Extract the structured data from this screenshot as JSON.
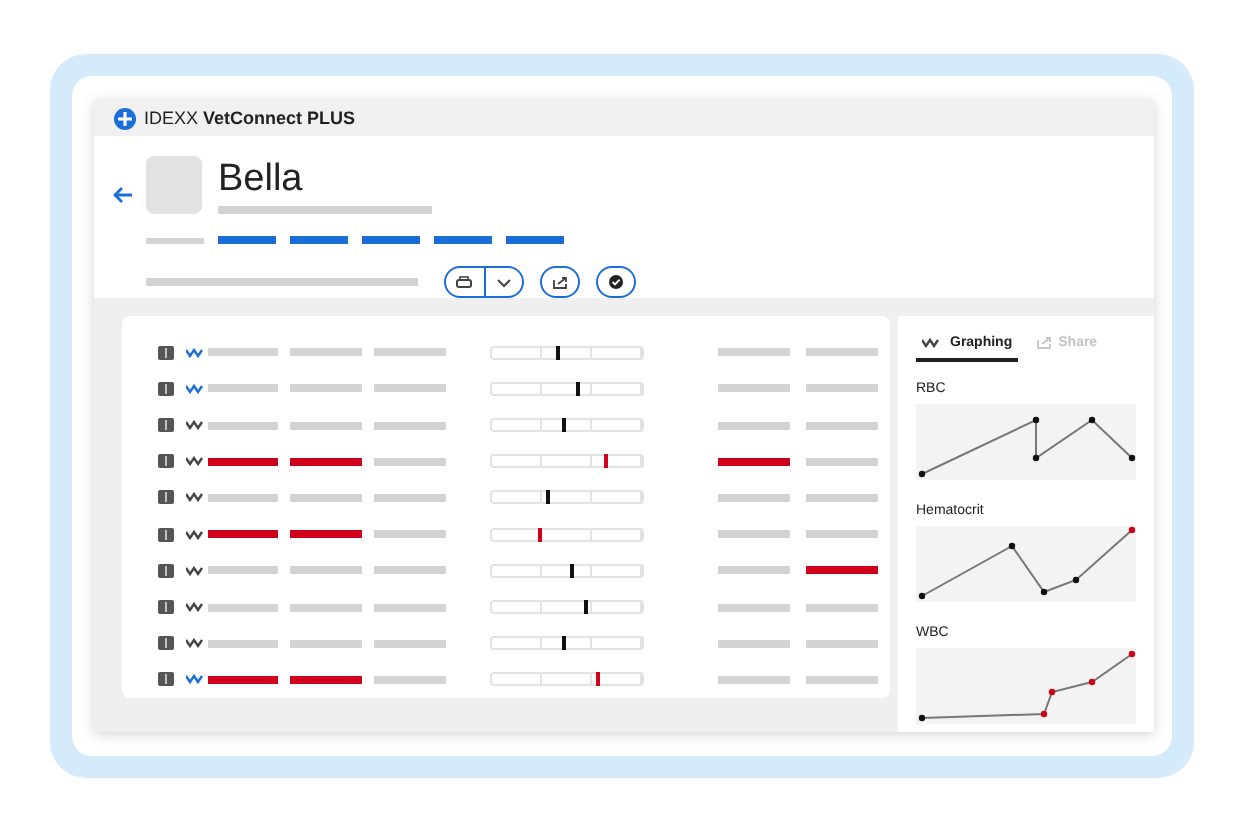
{
  "window": {
    "title": "IDEXX **VetConnect PLUS**"
  },
  "patient": {
    "name": "Bella"
  },
  "results": {
    "rows": [
      {
        "graph_active": true,
        "flags": [
          false,
          false,
          false,
          false,
          false
        ],
        "level": 0.43,
        "abnormal": false
      },
      {
        "graph_active": true,
        "flags": [
          false,
          false,
          false,
          false,
          false
        ],
        "level": 0.56,
        "abnormal": false
      },
      {
        "graph_active": false,
        "flags": [
          false,
          false,
          false,
          false,
          false
        ],
        "level": 0.47,
        "abnormal": false
      },
      {
        "graph_active": false,
        "flags": [
          true,
          true,
          false,
          true,
          false
        ],
        "level": 0.74,
        "abnormal": true
      },
      {
        "graph_active": false,
        "flags": [
          false,
          false,
          false,
          false,
          false
        ],
        "level": 0.36,
        "abnormal": false
      },
      {
        "graph_active": false,
        "flags": [
          true,
          true,
          false,
          false,
          false
        ],
        "level": 0.3,
        "abnormal": true
      },
      {
        "graph_active": false,
        "flags": [
          false,
          false,
          false,
          false,
          true
        ],
        "level": 0.52,
        "abnormal": false
      },
      {
        "graph_active": false,
        "flags": [
          false,
          false,
          false,
          false,
          false
        ],
        "level": 0.61,
        "abnormal": false
      },
      {
        "graph_active": false,
        "flags": [
          false,
          false,
          false,
          false,
          false
        ],
        "level": 0.47,
        "abnormal": false
      },
      {
        "graph_active": true,
        "flags": [
          true,
          true,
          false,
          false,
          false
        ],
        "level": 0.69,
        "abnormal": true
      }
    ]
  },
  "side_panel": {
    "tabs": [
      {
        "label": "Graphing",
        "kind": "graph",
        "selected": true
      },
      {
        "label": "Share",
        "kind": "share",
        "selected": false
      }
    ],
    "charts": [
      {
        "title": "RBC",
        "kind": "picture"
      },
      {
        "title": "Hematocrit",
        "kind": "picture"
      },
      {
        "title": "WBC",
        "kind": "picture"
      }
    ]
  }
}
